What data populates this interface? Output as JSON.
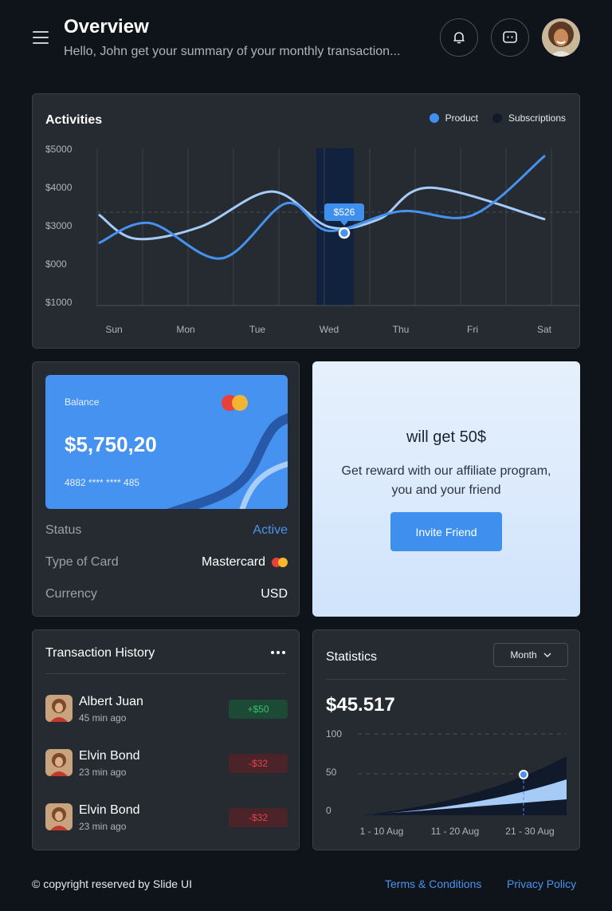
{
  "header": {
    "title": "Overview",
    "subtitle": "Hello, John get your summary of your monthly transaction..."
  },
  "activities": {
    "title": "Activities",
    "legend": [
      {
        "name": "Product",
        "color": "#3f8ff0"
      },
      {
        "name": "Subscriptions",
        "color": "#111a2b"
      }
    ]
  },
  "chart_data": {
    "type": "line",
    "title": "Activities",
    "categories": [
      "Sun",
      "Mon",
      "Tue",
      "Wed",
      "Thu",
      "Fri",
      "Sat"
    ],
    "y_tick_labels": [
      "$5000",
      "$4000",
      "$3000",
      "$000",
      "$1000"
    ],
    "highlight": {
      "category": "Wed",
      "label": "$526"
    },
    "series": [
      {
        "name": "Product",
        "color": "#4692f0",
        "x": [
          0,
          0.7,
          1.7,
          2.6,
          3.2,
          4.2,
          5.2,
          6.2
        ],
        "values": [
          2600,
          3100,
          2200,
          3600,
          2900,
          3400,
          3300,
          4800
        ]
      },
      {
        "name": "Subscriptions",
        "color": "#a6cbf7",
        "x": [
          0,
          0.5,
          1.4,
          2.4,
          3.2,
          3.9,
          4.6,
          6.2
        ],
        "values": [
          3300,
          2700,
          3000,
          3900,
          3000,
          3200,
          4000,
          3200
        ]
      }
    ],
    "grid": true
  },
  "balance": {
    "card_label": "Balance",
    "amount": "$5,750,20",
    "card_number": "4882 **** **** 485",
    "rows": [
      {
        "key": "Status",
        "value": "Active"
      },
      {
        "key": "Type of Card",
        "value": "Mastercard"
      },
      {
        "key": "Currency",
        "value": "USD"
      }
    ]
  },
  "affiliate": {
    "heading": "will get 50$",
    "text": "Get reward with our affiliate program, you and your friend",
    "button": "Invite Friend"
  },
  "transactions": {
    "title": "Transaction History",
    "items": [
      {
        "name": "Albert Juan",
        "time": "45 min ago",
        "amount": "+$50",
        "type": "pos"
      },
      {
        "name": "Elvin Bond",
        "time": "23 min ago",
        "amount": "-$32",
        "type": "neg"
      },
      {
        "name": "Elvin Bond",
        "time": "23 min ago",
        "amount": "-$32",
        "type": "neg"
      }
    ]
  },
  "statistics": {
    "title": "Statistics",
    "period": "Month",
    "amount": "$45.517",
    "y_ticks": [
      "100",
      "50",
      "0"
    ],
    "x_ticks": [
      "1 - 10 Aug",
      "11 - 20 Aug",
      "21 - 30 Aug"
    ],
    "highlight_value": 50
  },
  "footer": {
    "copyright": "© copyright reserved by Slide UI",
    "terms": "Terms & Conditions",
    "privacy": "Privacy Policy"
  }
}
